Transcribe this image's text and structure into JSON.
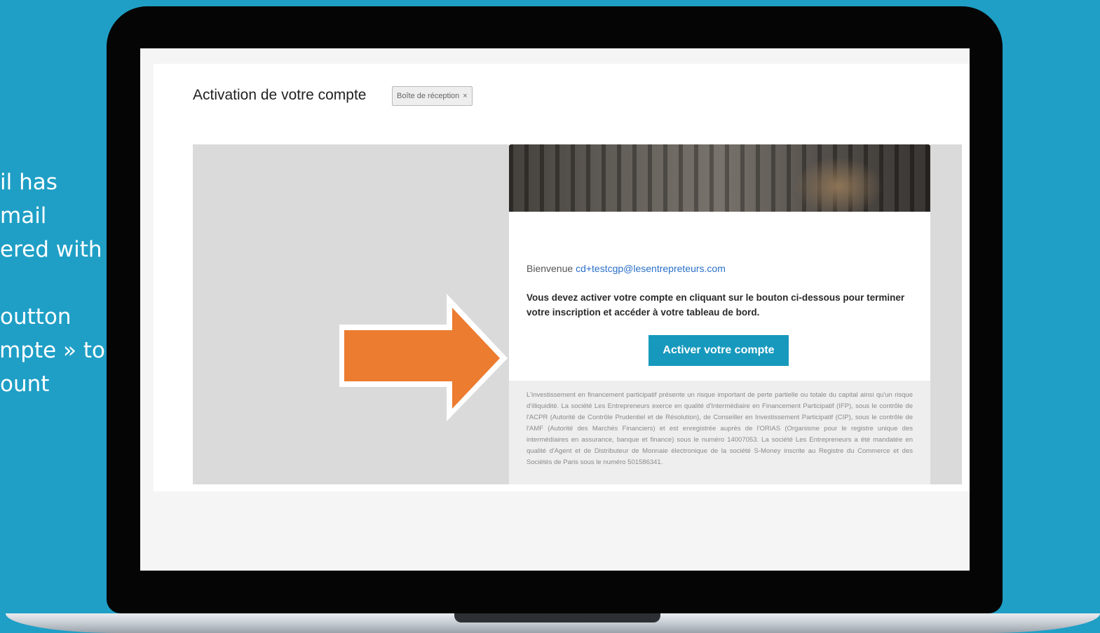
{
  "side_text": {
    "lines": [
      "il has",
      "mail",
      "ered with",
      "",
      "outton",
      "mpte » to",
      "ount"
    ]
  },
  "email": {
    "subject": "Activation de votre compte",
    "label": "Boîte de réception",
    "label_close": "×",
    "greeting_prefix": "Bienvenue",
    "greeting_email": "cd+testcgp@lesentrepreteurs.com",
    "instruction": "Vous devez activer votre compte en cliquant sur le bouton ci-dessous pour terminer votre inscription et accéder à votre tableau de bord.",
    "button_label": "Activer votre compte",
    "disclaimer": "L'investissement en financement participatif présente un risque important de perte partielle ou totale du capital ainsi qu'un risque d'illiquidité. La société Les Entrepreneurs exerce en qualité d'Intermédiaire en Financement Participatif (IFP), sous le contrôle de l'ACPR (Autorité de Contrôle Prudentiel et de Résolution), de Conseiller en Investissement Participatif (CIP), sous le contrôle de l'AMF (Autorité des Marchés Financiers) et est enregistrée auprès de l'ORIAS (Organisme pour le registre unique des intermédiaires en assurance, banque et finance) sous le numéro 14007053. La société Les Entrepreneurs a été mandatée en qualité d'Agent et de Distributeur de Monnaie électronique de la société S-Money inscrite au Registre du Commerce et des Sociétés de Paris sous le numéro 501586341."
  },
  "colors": {
    "background": "#1f9fc6",
    "button": "#1699bd",
    "arrow": "#ec7c30",
    "link": "#2a6fc9"
  }
}
